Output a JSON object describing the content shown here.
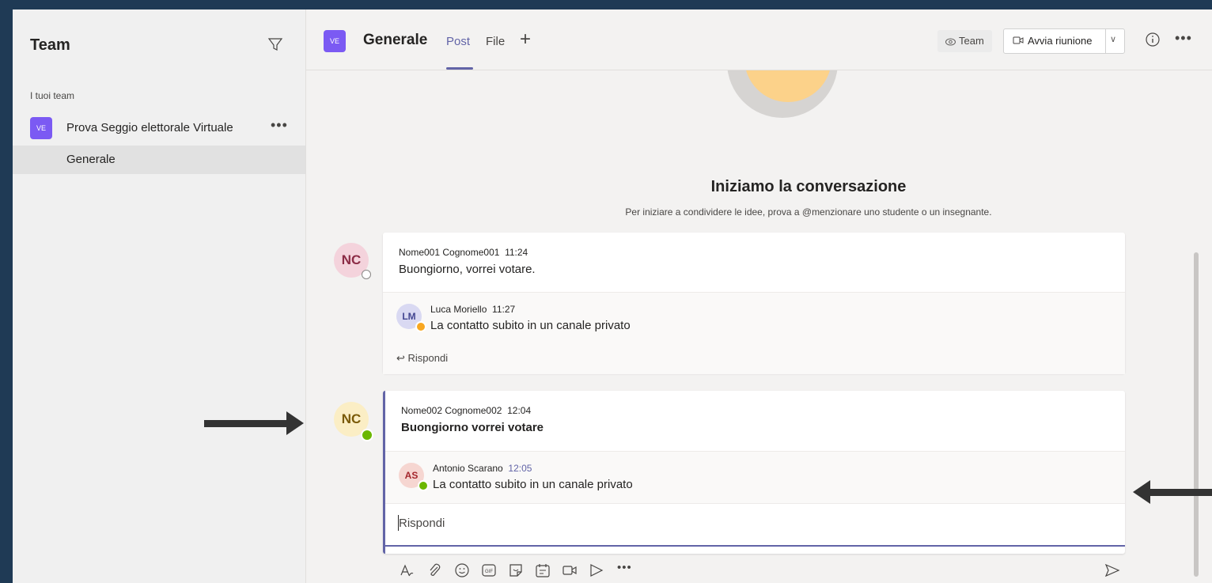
{
  "sidebar": {
    "title": "Team",
    "section_label": "I tuoi team",
    "team": {
      "avatar_text": "VE",
      "name": "Prova Seggio elettorale Virtuale",
      "more": "•••"
    },
    "channel": {
      "name": "Generale"
    }
  },
  "header": {
    "avatar_text": "VE",
    "title": "Generale",
    "tabs": [
      {
        "label": "Post",
        "active": true
      },
      {
        "label": "File",
        "active": false
      }
    ],
    "add_tab": "+",
    "team_button": "Team",
    "meet_button": "Avvia riunione",
    "more": "•••"
  },
  "conversation": {
    "title": "Iniziamo la conversazione",
    "subtitle": "Per iniziare a condividere le idee, prova a @menzionare uno studente o un insegnante."
  },
  "threads": [
    {
      "avatar": "NC",
      "author": "Nome001 Cognome001",
      "time": "11:24",
      "text": "Buongiorno, vorrei votare.",
      "reply": {
        "avatar": "LM",
        "author": "Luca Moriello",
        "time": "11:27",
        "text": "La contatto subito in un canale privato"
      },
      "reply_link": "Rispondi"
    },
    {
      "avatar": "NC",
      "author": "Nome002 Cognome002",
      "time": "12:04",
      "text": "Buongiorno vorrei votare",
      "reply": {
        "avatar": "AS",
        "author": "Antonio Scarano",
        "time": "12:05",
        "text": "La contatto subito in un canale privato"
      },
      "reply_placeholder": "Rispondi"
    }
  ],
  "composer": {
    "more": "•••"
  },
  "colors": {
    "accent": "#6264a7",
    "team_avatar": "#7b5af3",
    "online": "#6bb700",
    "away": "#f8a721"
  }
}
